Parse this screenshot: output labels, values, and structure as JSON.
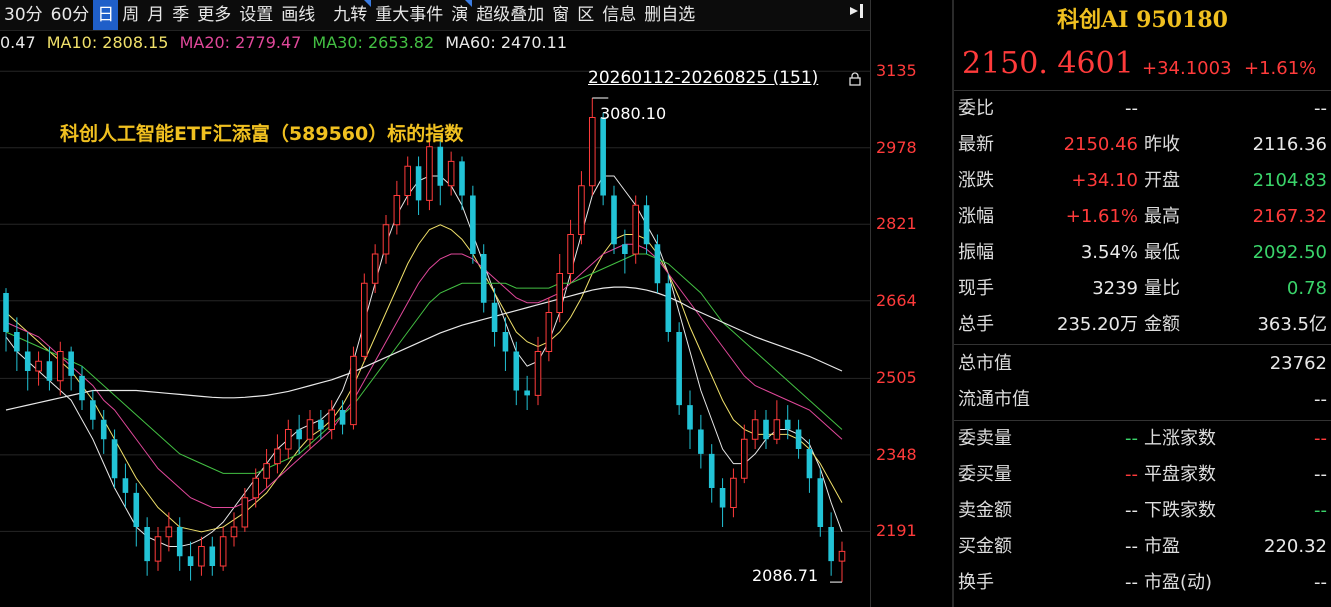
{
  "toolbar": {
    "items": [
      "30分",
      "60分",
      "日",
      "周",
      "月",
      "季",
      "更多",
      "设置",
      "画线",
      "九转",
      "重大事件",
      "演",
      "超级叠加",
      "窗",
      "区",
      "信息",
      "删自选"
    ],
    "active_index": 2
  },
  "ma": {
    "ma5": "0.47",
    "ma10": "MA10: 2808.15",
    "ma20": "MA20: 2779.47",
    "ma30": "MA30: 2653.82",
    "ma60": "MA60: 2470.11"
  },
  "chart": {
    "range_label": "20260112-20260825 (151)",
    "note": "科创人工智能ETF汇添富（589560）标的指数",
    "high_label": "3080.10",
    "low_label": "2086.71",
    "axis_labels": [
      "3135",
      "2978",
      "2821",
      "2664",
      "2505",
      "2348",
      "2191"
    ],
    "colors": {
      "up": "#ff3b3b",
      "down": "#22c3d6",
      "ma5": "#e8e8e8",
      "ma10": "#f0e06a",
      "ma20": "#e0489a",
      "ma30": "#43c043",
      "ma60": "#e8e8e8"
    }
  },
  "chart_data": {
    "type": "candlestick",
    "ylim": [
      2040,
      3160
    ],
    "candles": [
      [
        2680,
        2600,
        2690,
        2560
      ],
      [
        2600,
        2560,
        2630,
        2520
      ],
      [
        2560,
        2520,
        2600,
        2480
      ],
      [
        2520,
        2540,
        2560,
        2490
      ],
      [
        2540,
        2500,
        2570,
        2480
      ],
      [
        2500,
        2560,
        2580,
        2470
      ],
      [
        2560,
        2510,
        2570,
        2480
      ],
      [
        2510,
        2460,
        2530,
        2440
      ],
      [
        2460,
        2420,
        2480,
        2400
      ],
      [
        2420,
        2380,
        2440,
        2350
      ],
      [
        2380,
        2300,
        2400,
        2280
      ],
      [
        2300,
        2270,
        2330,
        2240
      ],
      [
        2270,
        2200,
        2290,
        2160
      ],
      [
        2200,
        2130,
        2220,
        2100
      ],
      [
        2130,
        2180,
        2200,
        2110
      ],
      [
        2180,
        2200,
        2230,
        2150
      ],
      [
        2200,
        2140,
        2220,
        2110
      ],
      [
        2140,
        2120,
        2170,
        2090
      ],
      [
        2120,
        2160,
        2180,
        2100
      ],
      [
        2160,
        2120,
        2180,
        2100
      ],
      [
        2120,
        2180,
        2200,
        2110
      ],
      [
        2180,
        2200,
        2230,
        2160
      ],
      [
        2200,
        2260,
        2280,
        2190
      ],
      [
        2260,
        2300,
        2320,
        2240
      ],
      [
        2300,
        2330,
        2360,
        2280
      ],
      [
        2330,
        2360,
        2390,
        2310
      ],
      [
        2360,
        2400,
        2420,
        2340
      ],
      [
        2400,
        2380,
        2430,
        2350
      ],
      [
        2380,
        2420,
        2440,
        2360
      ],
      [
        2420,
        2400,
        2440,
        2380
      ],
      [
        2400,
        2440,
        2460,
        2380
      ],
      [
        2440,
        2410,
        2460,
        2390
      ],
      [
        2410,
        2550,
        2570,
        2400
      ],
      [
        2550,
        2700,
        2720,
        2540
      ],
      [
        2700,
        2760,
        2780,
        2680
      ],
      [
        2760,
        2820,
        2840,
        2740
      ],
      [
        2820,
        2880,
        2910,
        2800
      ],
      [
        2880,
        2940,
        2960,
        2860
      ],
      [
        2940,
        2870,
        2960,
        2840
      ],
      [
        2870,
        2980,
        3000,
        2850
      ],
      [
        2980,
        2900,
        3000,
        2860
      ],
      [
        2900,
        2950,
        2970,
        2880
      ],
      [
        2950,
        2880,
        2960,
        2850
      ],
      [
        2880,
        2760,
        2900,
        2740
      ],
      [
        2760,
        2660,
        2780,
        2640
      ],
      [
        2660,
        2600,
        2690,
        2570
      ],
      [
        2600,
        2560,
        2630,
        2520
      ],
      [
        2560,
        2480,
        2580,
        2450
      ],
      [
        2480,
        2470,
        2510,
        2440
      ],
      [
        2470,
        2560,
        2590,
        2450
      ],
      [
        2560,
        2640,
        2670,
        2540
      ],
      [
        2640,
        2720,
        2760,
        2620
      ],
      [
        2720,
        2800,
        2830,
        2700
      ],
      [
        2800,
        2900,
        2930,
        2780
      ],
      [
        2900,
        3040,
        3080,
        2880
      ],
      [
        3040,
        2880,
        3050,
        2860
      ],
      [
        2880,
        2780,
        2900,
        2760
      ],
      [
        2780,
        2760,
        2810,
        2720
      ],
      [
        2760,
        2860,
        2880,
        2740
      ],
      [
        2860,
        2780,
        2880,
        2760
      ],
      [
        2780,
        2700,
        2800,
        2680
      ],
      [
        2700,
        2600,
        2720,
        2580
      ],
      [
        2600,
        2450,
        2620,
        2430
      ],
      [
        2450,
        2400,
        2480,
        2360
      ],
      [
        2400,
        2350,
        2430,
        2320
      ],
      [
        2350,
        2280,
        2370,
        2250
      ],
      [
        2280,
        2240,
        2300,
        2200
      ],
      [
        2240,
        2300,
        2320,
        2220
      ],
      [
        2300,
        2380,
        2410,
        2290
      ],
      [
        2380,
        2420,
        2440,
        2360
      ],
      [
        2420,
        2380,
        2440,
        2360
      ],
      [
        2380,
        2420,
        2460,
        2370
      ],
      [
        2420,
        2400,
        2450,
        2380
      ],
      [
        2400,
        2360,
        2420,
        2340
      ],
      [
        2360,
        2300,
        2380,
        2270
      ],
      [
        2300,
        2200,
        2320,
        2180
      ],
      [
        2200,
        2130,
        2230,
        2100
      ],
      [
        2130,
        2150,
        2170,
        2087
      ]
    ],
    "ma_series": {
      "ma5": [
        2590,
        2560,
        2540,
        2520,
        2500,
        2480,
        2460,
        2420,
        2380,
        2330,
        2280,
        2240,
        2200,
        2180,
        2170,
        2160,
        2160,
        2165,
        2175,
        2190,
        2210,
        2240,
        2270,
        2300,
        2330,
        2360,
        2380,
        2400,
        2410,
        2420,
        2440,
        2480,
        2540,
        2620,
        2700,
        2780,
        2840,
        2880,
        2910,
        2920,
        2920,
        2900,
        2860,
        2800,
        2740,
        2680,
        2620,
        2560,
        2530,
        2540,
        2580,
        2640,
        2720,
        2800,
        2880,
        2920,
        2920,
        2890,
        2860,
        2820,
        2780,
        2720,
        2640,
        2560,
        2480,
        2420,
        2360,
        2330,
        2330,
        2350,
        2380,
        2400,
        2400,
        2390,
        2370,
        2320,
        2250,
        2190
      ],
      "ma10": [
        2640,
        2620,
        2600,
        2580,
        2560,
        2540,
        2520,
        2490,
        2460,
        2420,
        2380,
        2340,
        2300,
        2270,
        2240,
        2220,
        2200,
        2195,
        2190,
        2195,
        2200,
        2215,
        2230,
        2250,
        2270,
        2300,
        2330,
        2360,
        2385,
        2400,
        2420,
        2450,
        2490,
        2540,
        2590,
        2640,
        2690,
        2740,
        2780,
        2810,
        2820,
        2810,
        2790,
        2760,
        2720,
        2680,
        2640,
        2600,
        2580,
        2570,
        2580,
        2600,
        2630,
        2670,
        2720,
        2760,
        2790,
        2800,
        2800,
        2790,
        2760,
        2720,
        2670,
        2610,
        2560,
        2510,
        2460,
        2420,
        2400,
        2390,
        2390,
        2390,
        2390,
        2380,
        2360,
        2330,
        2290,
        2250
      ],
      "ma20": [
        2620,
        2610,
        2600,
        2590,
        2570,
        2550,
        2530,
        2510,
        2490,
        2460,
        2440,
        2410,
        2380,
        2350,
        2320,
        2300,
        2280,
        2260,
        2250,
        2240,
        2240,
        2240,
        2250,
        2260,
        2280,
        2300,
        2320,
        2340,
        2360,
        2380,
        2400,
        2430,
        2460,
        2500,
        2540,
        2580,
        2620,
        2660,
        2700,
        2730,
        2750,
        2760,
        2760,
        2750,
        2730,
        2710,
        2690,
        2670,
        2660,
        2660,
        2670,
        2680,
        2700,
        2720,
        2740,
        2760,
        2770,
        2780,
        2780,
        2770,
        2750,
        2720,
        2690,
        2660,
        2630,
        2600,
        2570,
        2540,
        2510,
        2490,
        2480,
        2470,
        2460,
        2450,
        2440,
        2420,
        2400,
        2380
      ],
      "ma30": [
        2600,
        2590,
        2580,
        2570,
        2560,
        2550,
        2540,
        2530,
        2510,
        2490,
        2470,
        2450,
        2430,
        2410,
        2390,
        2370,
        2350,
        2340,
        2330,
        2320,
        2310,
        2310,
        2310,
        2310,
        2320,
        2330,
        2340,
        2350,
        2370,
        2390,
        2410,
        2430,
        2450,
        2480,
        2510,
        2540,
        2570,
        2600,
        2630,
        2660,
        2680,
        2690,
        2700,
        2700,
        2700,
        2700,
        2700,
        2690,
        2690,
        2690,
        2690,
        2700,
        2700,
        2710,
        2720,
        2730,
        2740,
        2750,
        2760,
        2760,
        2750,
        2740,
        2720,
        2700,
        2680,
        2650,
        2620,
        2600,
        2580,
        2560,
        2540,
        2520,
        2500,
        2480,
        2460,
        2440,
        2420,
        2400
      ],
      "ma60": [
        2440,
        2445,
        2450,
        2455,
        2460,
        2465,
        2470,
        2475,
        2480,
        2480,
        2480,
        2480,
        2480,
        2478,
        2476,
        2474,
        2472,
        2470,
        2468,
        2466,
        2465,
        2465,
        2466,
        2468,
        2470,
        2474,
        2478,
        2484,
        2490,
        2496,
        2502,
        2510,
        2518,
        2528,
        2538,
        2548,
        2558,
        2568,
        2578,
        2588,
        2598,
        2606,
        2614,
        2620,
        2626,
        2632,
        2638,
        2644,
        2650,
        2656,
        2662,
        2668,
        2674,
        2680,
        2686,
        2690,
        2692,
        2692,
        2690,
        2686,
        2680,
        2672,
        2662,
        2650,
        2640,
        2630,
        2620,
        2610,
        2600,
        2590,
        2582,
        2574,
        2566,
        2558,
        2550,
        2540,
        2530,
        2520
      ]
    }
  },
  "quote": {
    "title": "科创AI 950180",
    "price": "2150. 4601",
    "change": "+34.1003",
    "change_pct": "+1.61%",
    "rows1": [
      {
        "l1": "委比",
        "v1": "--",
        "l2": "",
        "v2": "--",
        "c1": "white",
        "c2": "white"
      },
      {
        "l1": "最新",
        "v1": "2150.46",
        "l2": "昨收",
        "v2": "2116.36",
        "c1": "red",
        "c2": "white"
      },
      {
        "l1": "涨跌",
        "v1": "+34.10",
        "l2": "开盘",
        "v2": "2104.83",
        "c1": "red",
        "c2": "green"
      },
      {
        "l1": "涨幅",
        "v1": "+1.61%",
        "l2": "最高",
        "v2": "2167.32",
        "c1": "red",
        "c2": "red"
      },
      {
        "l1": "振幅",
        "v1": "3.54%",
        "l2": "最低",
        "v2": "2092.50",
        "c1": "white",
        "c2": "green"
      },
      {
        "l1": "现手",
        "v1": "3239",
        "l2": "量比",
        "v2": "0.78",
        "c1": "white",
        "c2": "green"
      },
      {
        "l1": "总手",
        "v1": "235.20万",
        "l2": "金额",
        "v2": "363.5亿",
        "c1": "white",
        "c2": "white"
      }
    ],
    "rows2": [
      {
        "l1": "总市值",
        "v1": "",
        "l2": "",
        "v2": "23762",
        "c1": "white",
        "c2": "white"
      },
      {
        "l1": "流通市值",
        "v1": "",
        "l2": "",
        "v2": "--",
        "c1": "white",
        "c2": "white"
      }
    ],
    "rows3": [
      {
        "l1": "委卖量",
        "v1": "--",
        "l2": "上涨家数",
        "v2": "--",
        "c1": "green",
        "c2": "red"
      },
      {
        "l1": "委买量",
        "v1": "--",
        "l2": "平盘家数",
        "v2": "--",
        "c1": "red",
        "c2": "white"
      },
      {
        "l1": "卖金额",
        "v1": "--",
        "l2": "下跌家数",
        "v2": "--",
        "c1": "white",
        "c2": "green"
      },
      {
        "l1": "买金额",
        "v1": "--",
        "l2": "市盈",
        "v2": "220.32",
        "c1": "white",
        "c2": "white"
      },
      {
        "l1": "换手",
        "v1": "--",
        "l2": "市盈(动)",
        "v2": "--",
        "c1": "white",
        "c2": "white"
      }
    ]
  }
}
